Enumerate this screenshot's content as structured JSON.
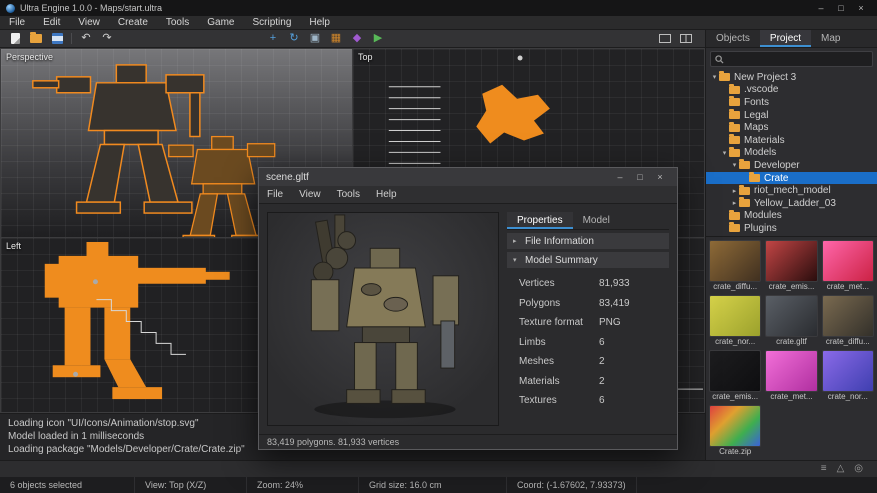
{
  "colors": {
    "accent_blue": "#3d8fd1",
    "selection_blue": "#1a6ec8",
    "folder_orange": "#e8a33d",
    "outline_orange": "#f18a1f"
  },
  "glyphs": {
    "expanded": "▾",
    "collapsed": "▸"
  },
  "window_controls": {
    "minimize": "–",
    "maximize": "□",
    "close": "×"
  },
  "title_bar": {
    "title": "Ultra Engine 1.0.0 - Maps/start.ultra"
  },
  "menu_bar": {
    "items": [
      "File",
      "Edit",
      "View",
      "Create",
      "Tools",
      "Game",
      "Scripting",
      "Help"
    ]
  },
  "toolbar": {
    "buttons_left": [
      {
        "icon": "new-file"
      },
      {
        "icon": "open-project"
      },
      {
        "icon": "save"
      }
    ],
    "buttons_history": [
      {
        "icon": "undo",
        "glyph": "↶"
      },
      {
        "icon": "redo",
        "glyph": "↷"
      }
    ],
    "buttons_tools": [
      {
        "icon": "translate-tool",
        "glyph": "+",
        "color": "#55a0dc"
      },
      {
        "icon": "rotate-tool",
        "glyph": "↻",
        "color": "#55a0dc"
      },
      {
        "icon": "scale-tool",
        "glyph": "▣",
        "color": "#9fb6c8"
      },
      {
        "icon": "create-brush",
        "glyph": "▦",
        "color": "#d0862a"
      },
      {
        "icon": "material-editor",
        "glyph": "◆",
        "color": "#a05ad0"
      },
      {
        "icon": "run-game",
        "glyph": "▶",
        "color": "#58b858"
      }
    ],
    "buttons_layout": [
      {
        "icon": "single-viewport"
      },
      {
        "icon": "split-viewport"
      }
    ]
  },
  "viewports": {
    "perspective_label": "Perspective",
    "top_label": "Top",
    "left_label": "Left"
  },
  "console": {
    "lines": [
      "Loading icon \"UI/Icons/Animation/stop.svg\"",
      "Model loaded in 1 milliseconds",
      "Loading package \"Models/Developer/Crate/Crate.zip\""
    ],
    "icons": [
      {
        "icon": "console-menu",
        "glyph": "≡"
      },
      {
        "icon": "warnings-filter",
        "glyph": "△"
      },
      {
        "icon": "messages-filter",
        "glyph": "◎"
      }
    ]
  },
  "status_bar": {
    "selection": "6 objects selected",
    "view": "View: Top (X/Z)",
    "zoom": "Zoom: 24%",
    "grid": "Grid size: 16.0 cm",
    "coord": "Coord: (-1.67602, 7.93373)"
  },
  "sidebar": {
    "tabs": [
      {
        "label": "Objects"
      },
      {
        "label": "Project",
        "active": true
      },
      {
        "label": "Map"
      }
    ],
    "search_placeholder": "",
    "tree": [
      {
        "label": "New Project 3",
        "level": 0,
        "arrow": "expanded"
      },
      {
        "label": ".vscode",
        "level": 1,
        "arrow": "none"
      },
      {
        "label": "Fonts",
        "level": 1,
        "arrow": "none"
      },
      {
        "label": "Legal",
        "level": 1,
        "arrow": "none"
      },
      {
        "label": "Maps",
        "level": 1,
        "arrow": "none"
      },
      {
        "label": "Materials",
        "level": 1,
        "arrow": "none"
      },
      {
        "label": "Models",
        "level": 1,
        "arrow": "expanded"
      },
      {
        "label": "Developer",
        "level": 2,
        "arrow": "expanded"
      },
      {
        "label": "Crate",
        "level": 3,
        "arrow": "none",
        "selected": true
      },
      {
        "label": "riot_mech_model",
        "level": 2,
        "arrow": "collapsed"
      },
      {
        "label": "Yellow_Ladder_03",
        "level": 2,
        "arrow": "collapsed"
      },
      {
        "label": "Modules",
        "level": 1,
        "arrow": "none"
      },
      {
        "label": "Plugins",
        "level": 1,
        "arrow": "none"
      }
    ],
    "assets": [
      {
        "label": "crate_diffu...",
        "colors": [
          "#8f6b38",
          "#403020"
        ]
      },
      {
        "label": "crate_emis...",
        "colors": [
          "#c24545",
          "#2a0d0d"
        ]
      },
      {
        "label": "crate_met...",
        "colors": [
          "#ff66aa",
          "#cc2244"
        ]
      },
      {
        "label": "crate_nor...",
        "colors": [
          "#d6d24a",
          "#9ba12c"
        ]
      },
      {
        "label": "crate.gltf",
        "colors": [
          "#5a5f66",
          "#2a2c30"
        ]
      },
      {
        "label": "crate_diffu...",
        "colors": [
          "#7a6a50",
          "#33302a"
        ]
      },
      {
        "label": "crate_emis...",
        "colors": [
          "#1d1d1f",
          "#0e0e10"
        ]
      },
      {
        "label": "crate_met...",
        "colors": [
          "#f26fd8",
          "#b02fa0"
        ]
      },
      {
        "label": "crate_nor...",
        "colors": [
          "#8a6ae8",
          "#3f3fb0"
        ]
      },
      {
        "label": "Crate.zip",
        "colors": [
          "#e04040",
          "#e0a030",
          "#3fae4f",
          "#3b62d8"
        ]
      }
    ]
  },
  "model_window": {
    "title": "scene.gltf",
    "menu": [
      "File",
      "View",
      "Tools",
      "Help"
    ],
    "tabs": [
      {
        "label": "Properties",
        "active": true
      },
      {
        "label": "Model"
      }
    ],
    "sections": [
      {
        "label": "File Information",
        "arrow": "collapsed"
      },
      {
        "label": "Model Summary",
        "arrow": "expanded"
      }
    ],
    "properties": [
      {
        "label": "Vertices",
        "value": "81,933"
      },
      {
        "label": "Polygons",
        "value": "83,419"
      },
      {
        "label": "Texture format",
        "value": "PNG"
      },
      {
        "label": "Limbs",
        "value": "6"
      },
      {
        "label": "Meshes",
        "value": "2"
      },
      {
        "label": "Materials",
        "value": "2"
      },
      {
        "label": "Textures",
        "value": "6"
      }
    ],
    "status": "83,419 polygons. 81,933 vertices"
  }
}
